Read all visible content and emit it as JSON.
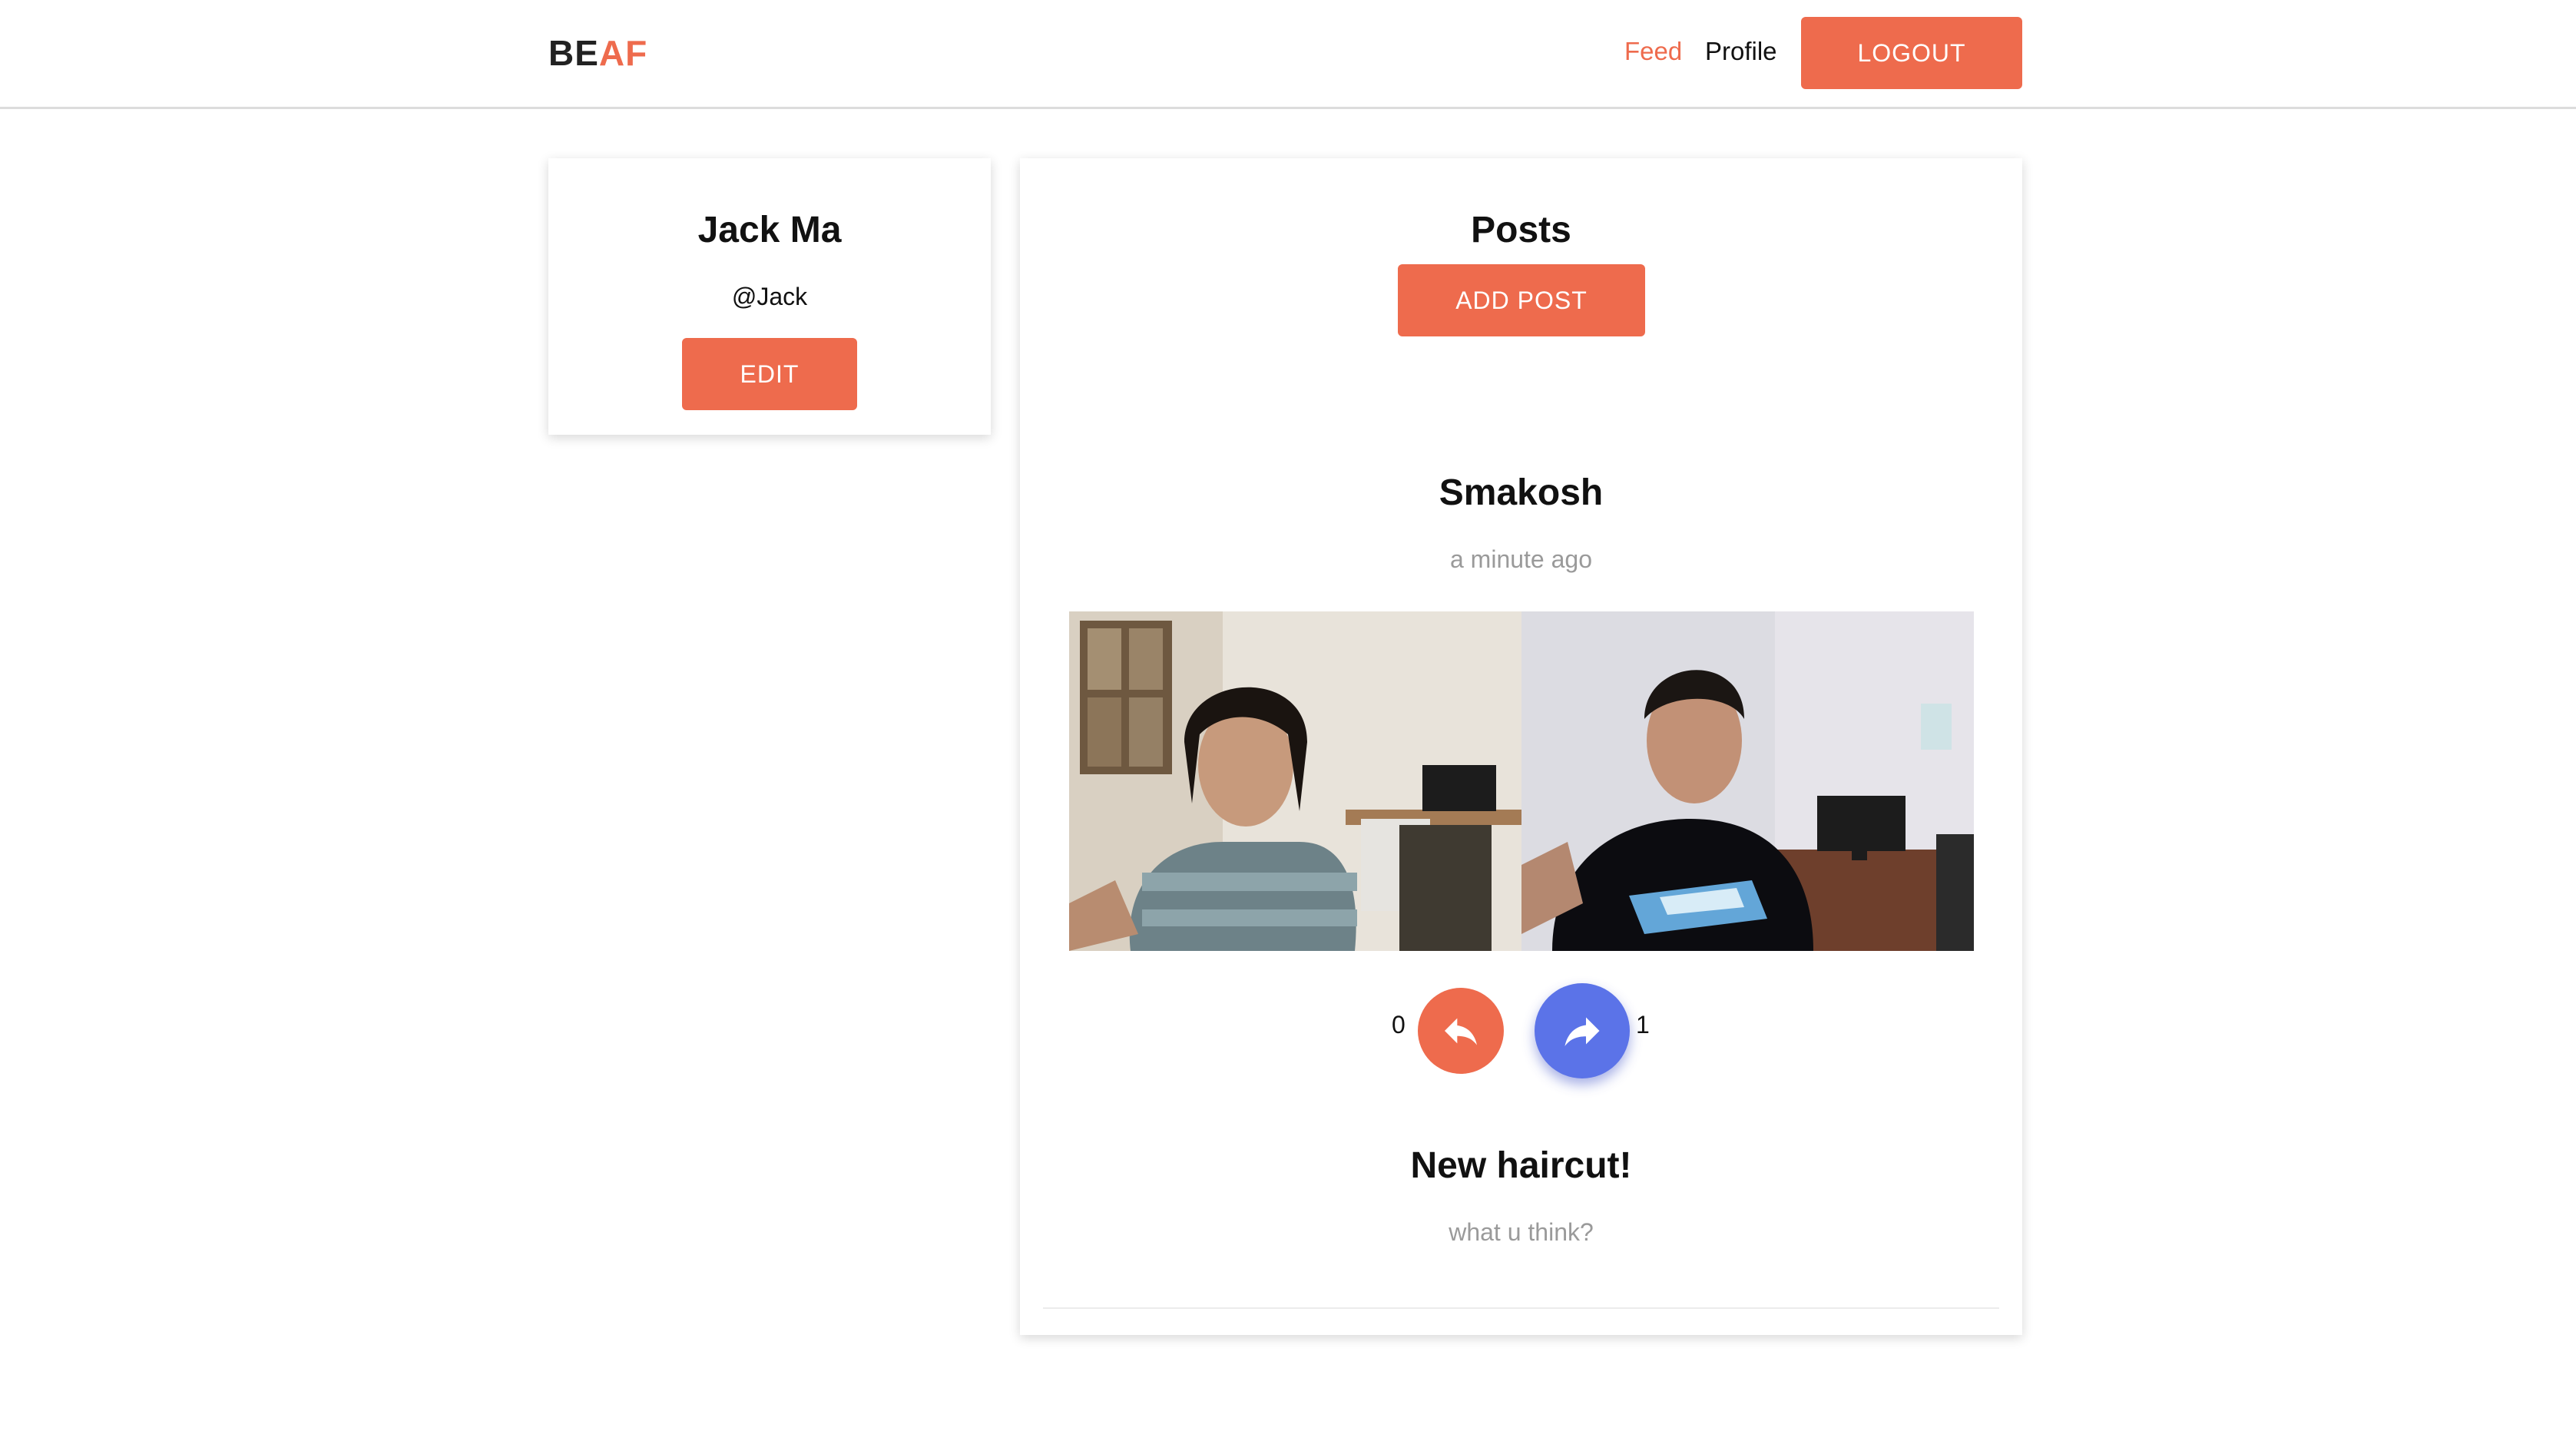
{
  "navbar": {
    "brand_part1": "BE",
    "brand_part2": "AF",
    "links": [
      {
        "label": "Feed"
      },
      {
        "label": "Profile"
      }
    ],
    "logout_label": "LOGOUT"
  },
  "profile": {
    "name": "Jack Ma",
    "handle": "@Jack",
    "edit_label": "EDIT"
  },
  "feed": {
    "title": "Posts",
    "add_post_label": "ADD POST",
    "posts": [
      {
        "author": "Smakosh",
        "time": "a minute ago",
        "reply_count": "0",
        "share_count": "1",
        "title": "New haircut!",
        "description": "what u think?"
      }
    ]
  },
  "colors": {
    "accent": "#ee6b4d",
    "share_button": "#5b73e8",
    "muted_text": "#9a9a9a"
  },
  "icons": [
    "reply-arrow-icon",
    "share-arrow-icon"
  ]
}
